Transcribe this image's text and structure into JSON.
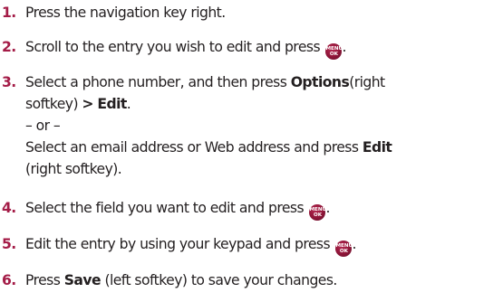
{
  "colors": {
    "number": "#a41c47",
    "icon": "#8e1538",
    "text": "#231f20"
  },
  "icon_names": [
    "menu-ok-key-icon"
  ],
  "menu_icon": {
    "line1": "MENU",
    "line2": "OK"
  },
  "steps": [
    {
      "number": "1.",
      "text": "Press the navigation key right."
    },
    {
      "number": "2.",
      "text_before": "Scroll to the entry you wish to edit and press",
      "text_after": "."
    },
    {
      "number": "3.",
      "text_before": "Select a phone number, and then press",
      "options": "Options",
      "text_mid": "(right",
      "line2_before": "softkey)",
      "line2_arrow": ">",
      "line2_edit": "Edit",
      "line2_after": ".",
      "or": "– or –",
      "alt_line1_before": "Select an email address or Web address and press",
      "alt_edit": "Edit",
      "alt_line2": "(right softkey)."
    },
    {
      "number": "4.",
      "text_before": "Select the field you want to edit and press",
      "text_after": "."
    },
    {
      "number": "5.",
      "text_before": "Edit the entry by using your keypad and press",
      "text_after": "."
    },
    {
      "number": "6.",
      "text_before": "Press",
      "save": "Save",
      "text_after": "(left softkey) to save your changes."
    }
  ]
}
